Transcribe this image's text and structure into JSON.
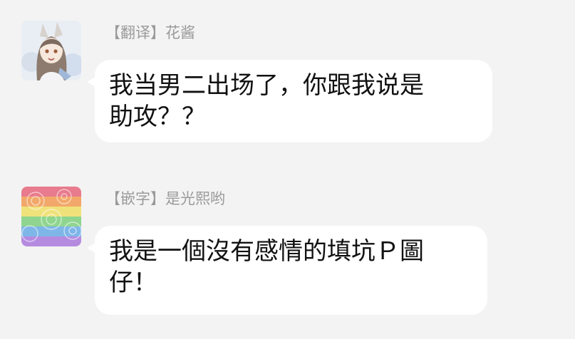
{
  "messages": [
    {
      "sender": "【翻译】花酱",
      "lines": [
        "我当男二出场了，你跟我说是",
        "助攻？？"
      ],
      "avatar": "anime-girl-avatar-icon"
    },
    {
      "sender": "【嵌字】是光熙哟",
      "lines": [
        "我是一個沒有感情的填坑Ｐ圖",
        "仔！"
      ],
      "avatar": "rainbow-roses-avatar-icon"
    }
  ],
  "colors": {
    "background": "#f3f3f3",
    "bubble": "#ffffff",
    "sender_name": "#9a9a9a",
    "message_text": "#111111"
  }
}
